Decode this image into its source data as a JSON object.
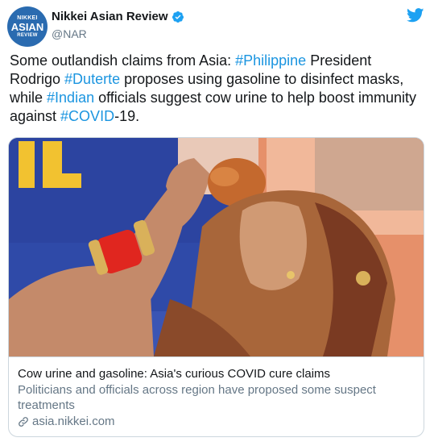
{
  "account": {
    "avatar_lines": [
      "NIKKEI",
      "ASIAN",
      "REVIEW"
    ],
    "display_name": "Nikkei Asian Review",
    "handle": "@NAR"
  },
  "tweet": {
    "segments": [
      {
        "text": "Some outlandish claims from Asia: ",
        "hashtag": false
      },
      {
        "text": "#Philippine",
        "hashtag": true
      },
      {
        "text": " President Rodrigo ",
        "hashtag": false
      },
      {
        "text": "#Duterte",
        "hashtag": true
      },
      {
        "text": " proposes using gasoline to disinfect masks, while ",
        "hashtag": false
      },
      {
        "text": "#Indian",
        "hashtag": true
      },
      {
        "text": " officials suggest cow urine to help boost immunity against ",
        "hashtag": false
      },
      {
        "text": "#COVID",
        "hashtag": true
      },
      {
        "text": "-19.",
        "hashtag": false
      }
    ]
  },
  "card": {
    "title": "Cow urine and gasoline: Asia's curious COVID cure claims",
    "description": "Politicians and officials across region have proposed some suspect treatments",
    "domain": "asia.nikkei.com"
  },
  "icons": {
    "verified": "verified-badge-icon",
    "platform": "twitter-bird-icon",
    "link": "link-icon"
  },
  "colors": {
    "hashtag": "#1b95e0",
    "verified": "#1da1f2",
    "avatar": "#2a6bb0"
  }
}
